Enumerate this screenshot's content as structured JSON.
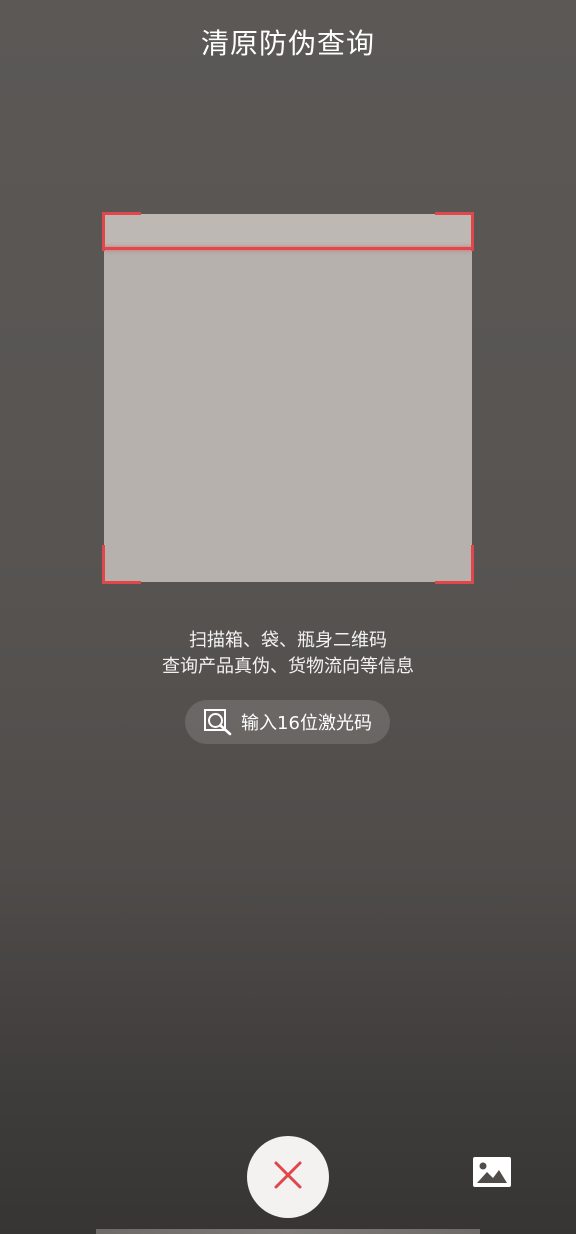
{
  "header": {
    "title": "清原防伪查询"
  },
  "scanner": {
    "hint_line1": "扫描箱、袋、瓶身二维码",
    "hint_line2": "查询产品真伪、货物流向等信息",
    "accent_color": "#e0464a"
  },
  "laser_code_button": {
    "icon": "search-icon",
    "label": "输入16位激光码"
  },
  "bottom_controls": {
    "close_icon": "close-icon",
    "gallery_icon": "image-gallery-icon"
  }
}
